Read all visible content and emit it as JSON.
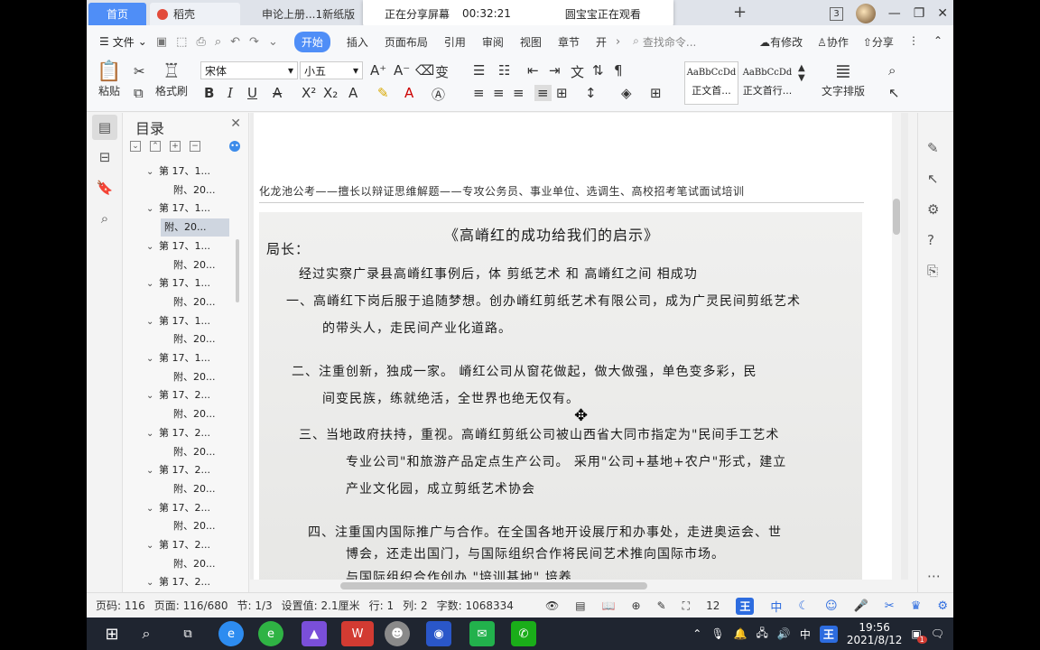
{
  "tabs": [
    {
      "label": "首页"
    },
    {
      "label": "稻壳"
    },
    {
      "label": "申论上册...1新纸版"
    }
  ],
  "share_banner": {
    "status": "正在分享屏幕",
    "time": "00:32:21",
    "viewer": "圆宝宝正在观看"
  },
  "window": {
    "badge": "3"
  },
  "menu": {
    "file": "文件",
    "items": [
      "开始",
      "插入",
      "页面布局",
      "引用",
      "审阅",
      "视图",
      "章节",
      "开"
    ],
    "search": "查找命令...",
    "right": [
      "有修改",
      "协作",
      "分享"
    ]
  },
  "ribbon": {
    "paste": "粘贴",
    "format_painter": "格式刷",
    "font": "宋体",
    "size": "小五",
    "style1_sample": "AaBbCcDd",
    "style1_label": "正文首...",
    "style2_sample": "AaBbCcDd",
    "style2_label": "正文首行...",
    "text_layout": "文字排版"
  },
  "toc": {
    "title": "目录",
    "items": [
      {
        "level": 1,
        "text": "第 17、1..."
      },
      {
        "level": 2,
        "text": "附、20..."
      },
      {
        "level": 1,
        "text": "第 17、1..."
      },
      {
        "level": 2,
        "text": "附、20...",
        "selected": true
      },
      {
        "level": 1,
        "text": "第 17、1..."
      },
      {
        "level": 2,
        "text": "附、20..."
      },
      {
        "level": 1,
        "text": "第 17、1..."
      },
      {
        "level": 2,
        "text": "附、20..."
      },
      {
        "level": 1,
        "text": "第 17、1..."
      },
      {
        "level": 2,
        "text": "附、20..."
      },
      {
        "level": 1,
        "text": "第 17、1..."
      },
      {
        "level": 2,
        "text": "附、20..."
      },
      {
        "level": 1,
        "text": "第 17、2..."
      },
      {
        "level": 2,
        "text": "附、20..."
      },
      {
        "level": 1,
        "text": "第 17、2..."
      },
      {
        "level": 2,
        "text": "附、20..."
      },
      {
        "level": 1,
        "text": "第 17、2..."
      },
      {
        "level": 2,
        "text": "附、20..."
      },
      {
        "level": 1,
        "text": "第 17、2..."
      },
      {
        "level": 2,
        "text": "附、20..."
      },
      {
        "level": 1,
        "text": "第 17、2..."
      },
      {
        "level": 2,
        "text": "附、20..."
      },
      {
        "level": 1,
        "text": "第 17、2..."
      }
    ]
  },
  "document": {
    "header": "化龙池公考——擅长以辩证思维解题——专攻公务员、事业单位、选调生、高校招考笔试面试培训",
    "handwriting": [
      "《高嵴红的成功给我们的启示》",
      "局长：",
      "经过实察广录县高嵴红事例后，体 剪纸艺术 和 高嵴红之间 相成功",
      "一、高嵴红下岗后服于追随梦想。创办嵴红剪纸艺术有限公司，成为广灵民间剪纸艺术",
      "的带头人，走民间产业化道路。",
      "二、注重创新，独成一家。  嵴红公司从窗花做起，做大做强，单色变多彩，民",
      "间变民族，练就绝活，全世界也绝无仅有。",
      "三、当地政府扶持，重视。高嵴红剪纸公司被山西省大同市指定为\"民间手工艺术",
      "专业公司\"和旅游产品定点生产公司。 采用\"公司+基地+农户\"形式，建立",
      "产业文化园，成立剪纸艺术协会",
      "四、注重国内国际推广与合作。在全国各地开设展厅和办事处，走进奥运会、世",
      "博会，还走出国门，与国际组织合作将民间艺术推向国际市场。",
      "                    与国际组织合作创办 \"培训基地\" 培养"
    ]
  },
  "status": {
    "page_code": "页码: 116",
    "page": "页面: 116/680",
    "section": "节: 1/3",
    "setting": "设置值: 2.1厘米",
    "row": "行: 1",
    "col": "列: 2",
    "chars": "字数: 1068334",
    "zoom": "12",
    "ime": "王",
    "lang": "中"
  },
  "taskbar": {
    "time": "19:56",
    "date": "2021/8/12",
    "lang": "中",
    "notif": "1"
  }
}
